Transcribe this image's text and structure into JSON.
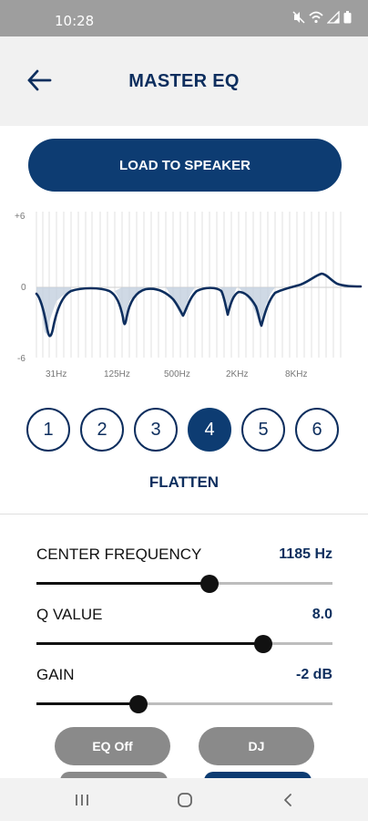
{
  "status": {
    "time": "10:28",
    "icons": [
      "mute-icon",
      "wifi-icon",
      "signal-icon",
      "battery-icon"
    ]
  },
  "header": {
    "title": "MASTER EQ",
    "back_icon": "arrow-left-icon"
  },
  "load_button": {
    "label": "LOAD TO SPEAKER"
  },
  "graph": {
    "y_labels": [
      "+6",
      "0",
      "-6"
    ],
    "x_labels": [
      "31Hz",
      "125Hz",
      "500Hz",
      "2KHz",
      "8KHz"
    ]
  },
  "bands": {
    "items": [
      "1",
      "2",
      "3",
      "4",
      "5",
      "6"
    ],
    "selected": "4"
  },
  "flatten_label": "FLATTEN",
  "controls": {
    "center_frequency": {
      "label": "CENTER FREQUENCY",
      "value": "1185 Hz",
      "level": 0.585
    },
    "q_value": {
      "label": "Q VALUE",
      "value": "8.0",
      "level": 0.766
    },
    "gain": {
      "label": "GAIN",
      "value": "-2 dB",
      "level": 0.345
    }
  },
  "buttons": {
    "eq_off": "EQ Off",
    "dj": "DJ"
  },
  "colors": {
    "primary": "#0d3c72",
    "pill_gray": "#8a8a8a",
    "status_bar": "#9e9e9e"
  }
}
